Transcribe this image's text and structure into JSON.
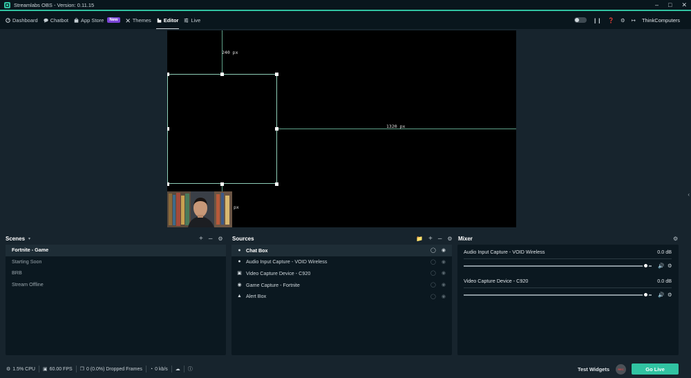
{
  "window": {
    "title": "Streamlabs OBS - Version: 0.11.15",
    "min_icon": "minimize-icon",
    "max_icon": "maximize-icon",
    "close_icon": "close-icon"
  },
  "nav": {
    "items": [
      {
        "label": "Dashboard",
        "icon": "dashboard-icon"
      },
      {
        "label": "Chatbot",
        "icon": "chatbot-icon"
      },
      {
        "label": "App Store",
        "icon": "store-icon",
        "badge": "New"
      },
      {
        "label": "Themes",
        "icon": "themes-icon"
      },
      {
        "label": "Editor",
        "icon": "editor-icon",
        "active": true
      },
      {
        "label": "Live",
        "icon": "live-icon"
      }
    ],
    "username": "ThinkComputers"
  },
  "editor": {
    "guide_top_label": "240 px",
    "guide_right_label": "1320 px",
    "guide_bottom_label": "px"
  },
  "scenes": {
    "title": "Scenes",
    "items": [
      "Fortnite - Game",
      "Starting Soon",
      "BRB",
      "Stream Offline"
    ],
    "selected_index": 0
  },
  "sources": {
    "title": "Sources",
    "items": [
      {
        "label": "Chat Box",
        "icon": "chat-icon"
      },
      {
        "label": "Audio Input Capture - VOID Wireless",
        "icon": "microphone-icon"
      },
      {
        "label": "Video Capture Device - C920",
        "icon": "webcam-icon"
      },
      {
        "label": "Game Capture - Fortnite",
        "icon": "gamepad-icon"
      },
      {
        "label": "Alert Box",
        "icon": "bell-icon"
      }
    ],
    "selected_index": 0
  },
  "mixer": {
    "title": "Mixer",
    "items": [
      {
        "name": "Audio Input Capture - VOID Wireless",
        "db": "0.0 dB",
        "volume": 1.0
      },
      {
        "name": "Video Capture Device - C920",
        "db": "0.0 dB",
        "volume": 1.0
      }
    ]
  },
  "footer": {
    "cpu": "1.5% CPU",
    "fps": "60.00 FPS",
    "dropped": "0 (0.0%) Dropped Frames",
    "bitrate": "0 kb/s",
    "test_widgets": "Test Widgets",
    "rec": "REC",
    "go_live": "Go Live"
  },
  "colors": {
    "accent": "#31c3a2",
    "background": "#17242d",
    "panel": "#0b1820",
    "new_badge": "#7a45d6"
  }
}
